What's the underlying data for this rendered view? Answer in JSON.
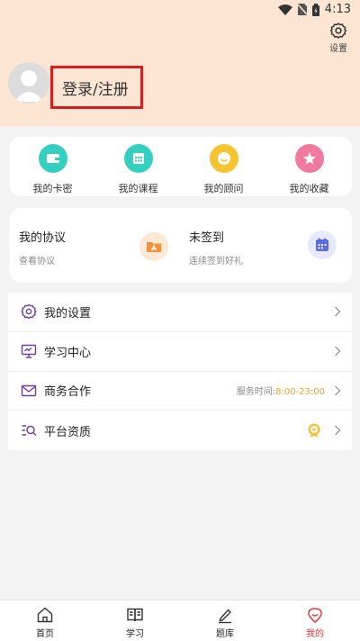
{
  "status": {
    "time": "4:13"
  },
  "header": {
    "settings_label": "设置",
    "login_label": "登录/注册"
  },
  "quick": [
    {
      "label": "我的卡密",
      "icon": "wallet-icon",
      "color": "#35cfc0"
    },
    {
      "label": "我的课程",
      "icon": "calendar-icon",
      "color": "#35cfc0"
    },
    {
      "label": "我的顾问",
      "icon": "smile-icon",
      "color": "#f6c430"
    },
    {
      "label": "我的收藏",
      "icon": "star-icon",
      "color": "#f07aa0"
    }
  ],
  "agreement": {
    "title": "我的协议",
    "sub": "查看协议",
    "icon": "pdf-icon"
  },
  "signin": {
    "title": "未签到",
    "sub": "连续签到好礼",
    "icon": "calendar-icon"
  },
  "menu": [
    {
      "label": "我的设置",
      "icon": "gear-icon"
    },
    {
      "label": "学习中心",
      "icon": "monitor-icon"
    },
    {
      "label": "商务合作",
      "icon": "mail-icon",
      "hint_prefix": "服务时间:",
      "hint_time": "8:00-23:00"
    },
    {
      "label": "平台资质",
      "icon": "search-list-icon",
      "badge": "award-icon"
    }
  ],
  "tabs": [
    {
      "label": "首页",
      "icon": "home-icon"
    },
    {
      "label": "学习",
      "icon": "book-icon"
    },
    {
      "label": "题库",
      "icon": "edit-icon"
    },
    {
      "label": "我的",
      "icon": "user-icon",
      "active": true
    }
  ],
  "colors": {
    "header_bg": "#fde5d3",
    "accent": "#e23a3a",
    "highlight_border": "#d6201f",
    "time": "#f0a01e"
  }
}
